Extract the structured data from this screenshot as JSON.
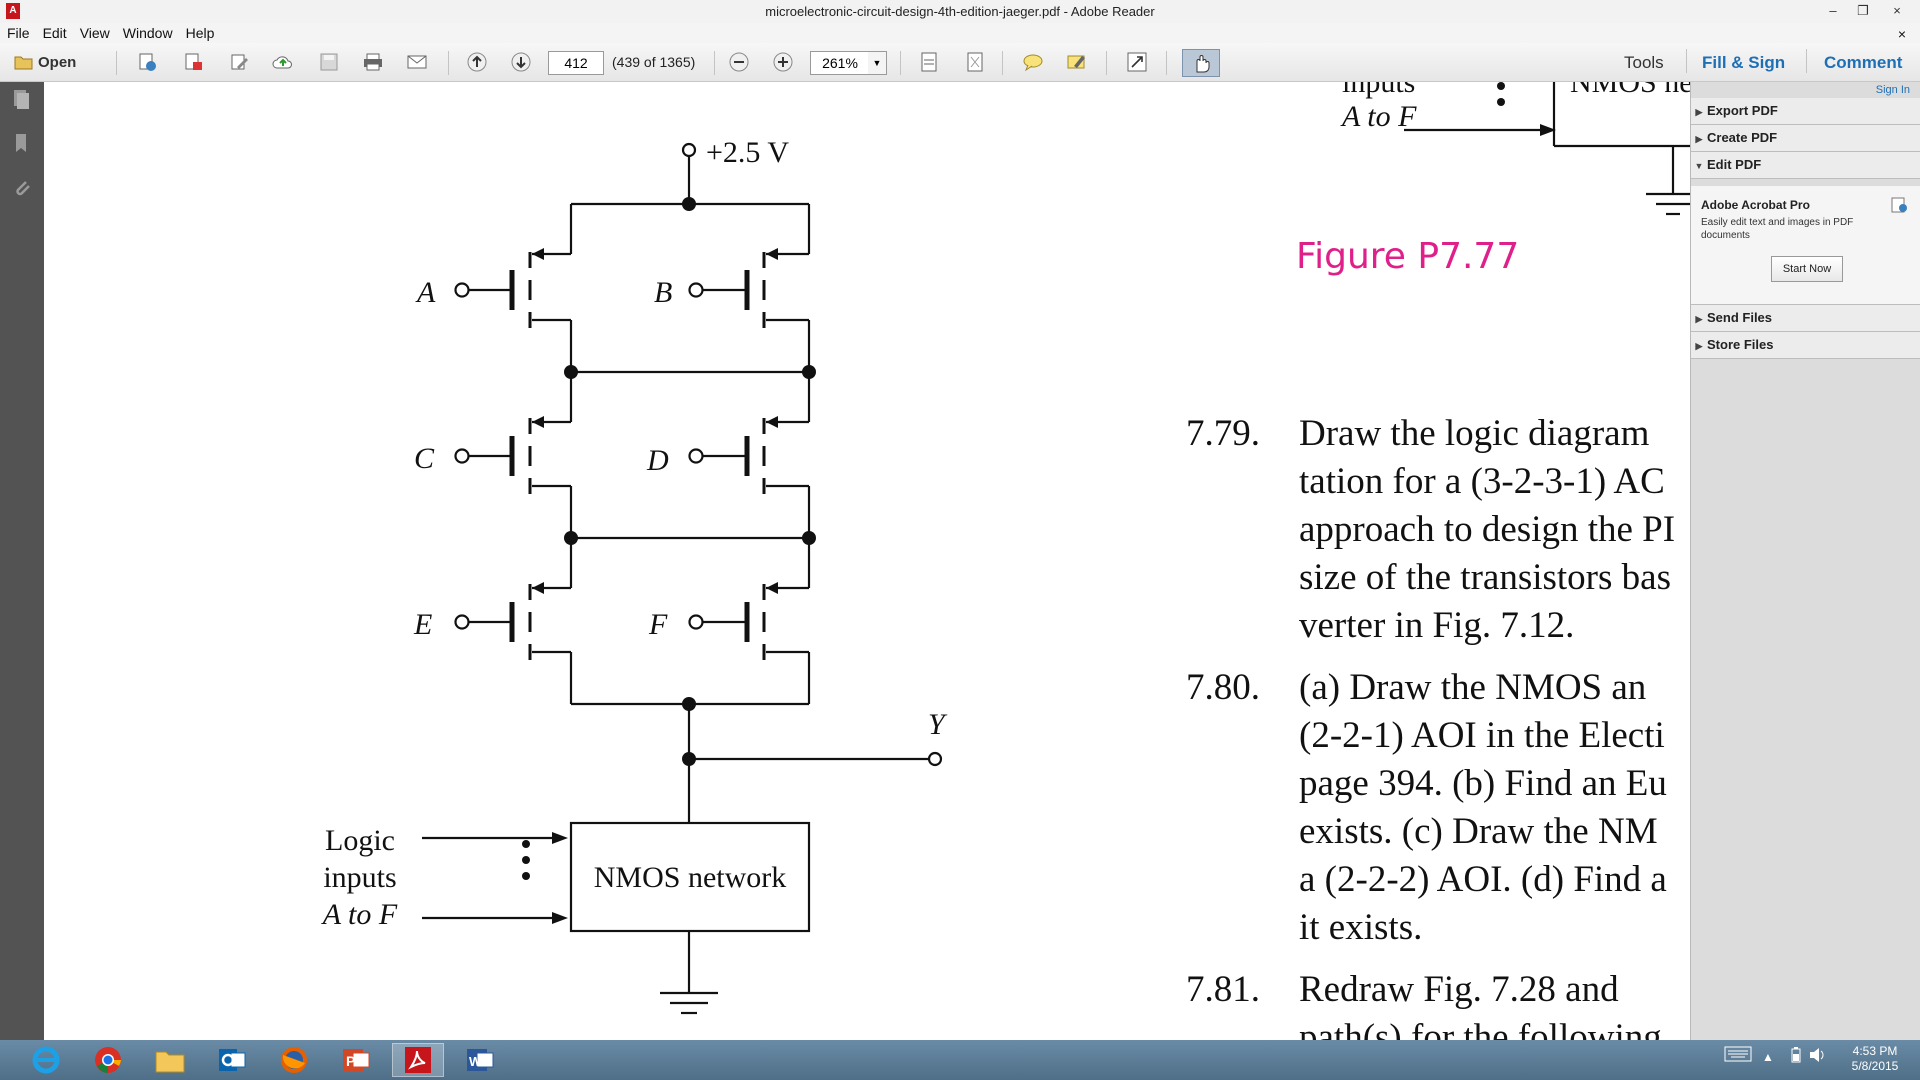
{
  "window": {
    "title": "microelectronic-circuit-design-4th-edition-jaeger.pdf - Adobe Reader",
    "minimize": "–",
    "restore": "❐",
    "close": "×"
  },
  "menu": {
    "items": [
      "File",
      "Edit",
      "View",
      "Window",
      "Help"
    ],
    "close": "×"
  },
  "toolbar": {
    "open_label": "Open",
    "page_number": "412",
    "page_count": "(439 of 1365)",
    "zoom": "261%",
    "tools_label": "Tools",
    "fill_sign_label": "Fill & Sign",
    "comment_label": "Comment",
    "accent_color": "#1f6fb5"
  },
  "side_panel": {
    "sign_in": "Sign In",
    "sections": [
      "Export PDF",
      "Create PDF",
      "Edit PDF",
      "Send Files",
      "Store Files"
    ],
    "promo_title": "Adobe Acrobat Pro",
    "promo_text": "Easily edit text and images in PDF documents",
    "start_button": "Start Now"
  },
  "document": {
    "figure_label": "Figure P7.77",
    "circuit": {
      "supply": "+2.5 V",
      "inputs": [
        "A",
        "B",
        "C",
        "D",
        "E",
        "F"
      ],
      "output": "Y",
      "network_label": "NMOS network",
      "logic_lines": [
        "Logic",
        "inputs",
        "A to F"
      ]
    },
    "top_fragment": {
      "inputs": "inputs",
      "a_to_f": "A to F",
      "nmos": "NMOS ne"
    },
    "problems": [
      {
        "num": "7.79.",
        "lines": [
          "Draw the logic diagram",
          "tation for a (3-2-3-1) AC",
          "approach to design the PI",
          "size of the transistors bas",
          "verter in Fig. 7.12."
        ]
      },
      {
        "num": "7.80.",
        "lines": [
          "(a) Draw the NMOS an",
          "(2-2-1) AOI in the Electi",
          "page 394. (b) Find an Eu",
          "exists. (c) Draw the NM",
          "a (2-2-2) AOI. (d) Find a",
          "it exists."
        ]
      },
      {
        "num": "7.81.",
        "lines": [
          "Redraw Fig. 7.28 and",
          "path(s) for the following"
        ]
      }
    ]
  },
  "taskbar": {
    "time": "4:53 PM",
    "date": "5/8/2015",
    "apps": [
      "internet-explorer",
      "chrome",
      "file-explorer",
      "outlook",
      "firefox",
      "powerpoint",
      "adobe-reader",
      "word"
    ]
  }
}
